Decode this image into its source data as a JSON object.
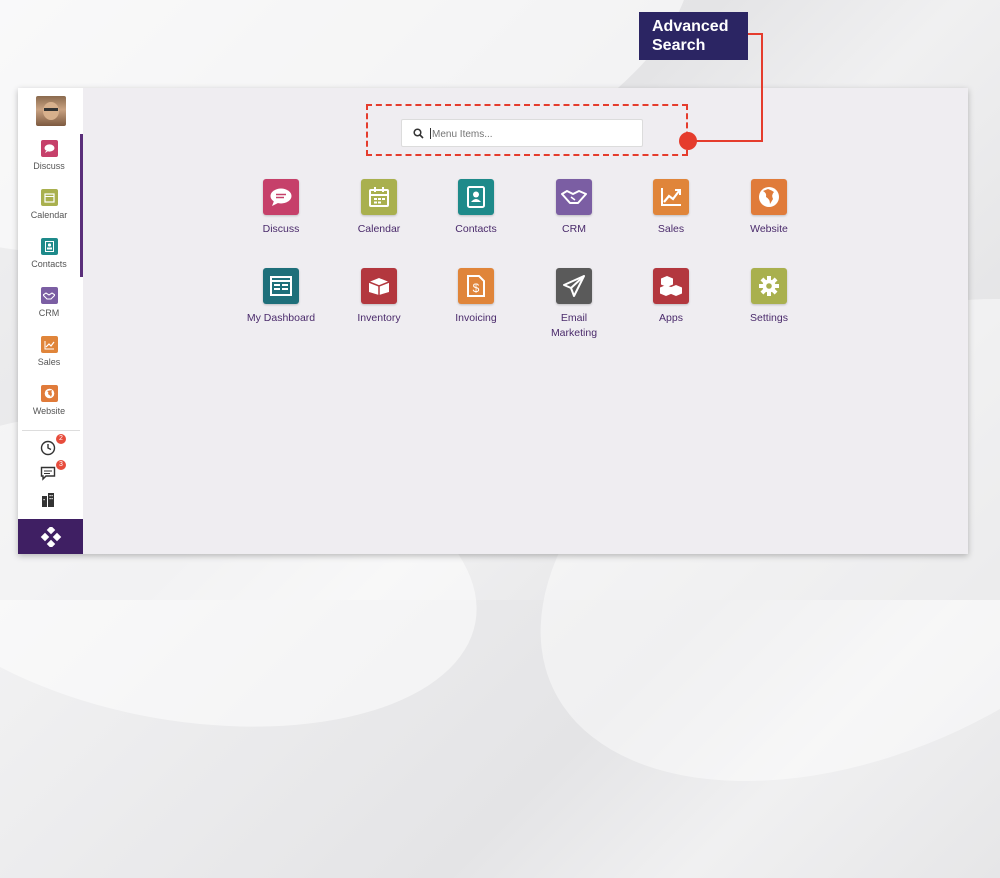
{
  "callout": {
    "line1": "Advanced",
    "line2": "Search"
  },
  "search": {
    "placeholder": "Menu Items..."
  },
  "sidebar": {
    "items": [
      {
        "label": "Discuss",
        "color": "#c6406a"
      },
      {
        "label": "Calendar",
        "color": "#a9b04e"
      },
      {
        "label": "Contacts",
        "color": "#1e8a8a"
      },
      {
        "label": "CRM",
        "color": "#7b5ea3"
      },
      {
        "label": "Sales",
        "color": "#e0853a"
      },
      {
        "label": "Website",
        "color": "#e07b3a"
      }
    ],
    "notifications": {
      "activity_count": "2",
      "messages_count": "3"
    }
  },
  "apps": [
    {
      "label": "Discuss",
      "icon": "chat-bubble-icon",
      "color": "#c6406a"
    },
    {
      "label": "Calendar",
      "icon": "calendar-icon",
      "color": "#a9b04e"
    },
    {
      "label": "Contacts",
      "icon": "contact-card-icon",
      "color": "#1e8a8a"
    },
    {
      "label": "CRM",
      "icon": "handshake-icon",
      "color": "#7b5ea3"
    },
    {
      "label": "Sales",
      "icon": "trend-chart-icon",
      "color": "#e0853a"
    },
    {
      "label": "Website",
      "icon": "globe-icon",
      "color": "#e07b3a"
    },
    {
      "label": "My Dashboard",
      "icon": "dashboard-icon",
      "color": "#1e6f7a"
    },
    {
      "label": "Inventory",
      "icon": "box-icon",
      "color": "#b3373e"
    },
    {
      "label": "Invoicing",
      "icon": "invoice-icon",
      "color": "#e0853a"
    },
    {
      "label": "Email Marketing",
      "icon": "paper-plane-icon",
      "color": "#5a5a5a"
    },
    {
      "label": "Apps",
      "icon": "cubes-icon",
      "color": "#b3373e"
    },
    {
      "label": "Settings",
      "icon": "gear-icon",
      "color": "#a9b04e"
    }
  ]
}
